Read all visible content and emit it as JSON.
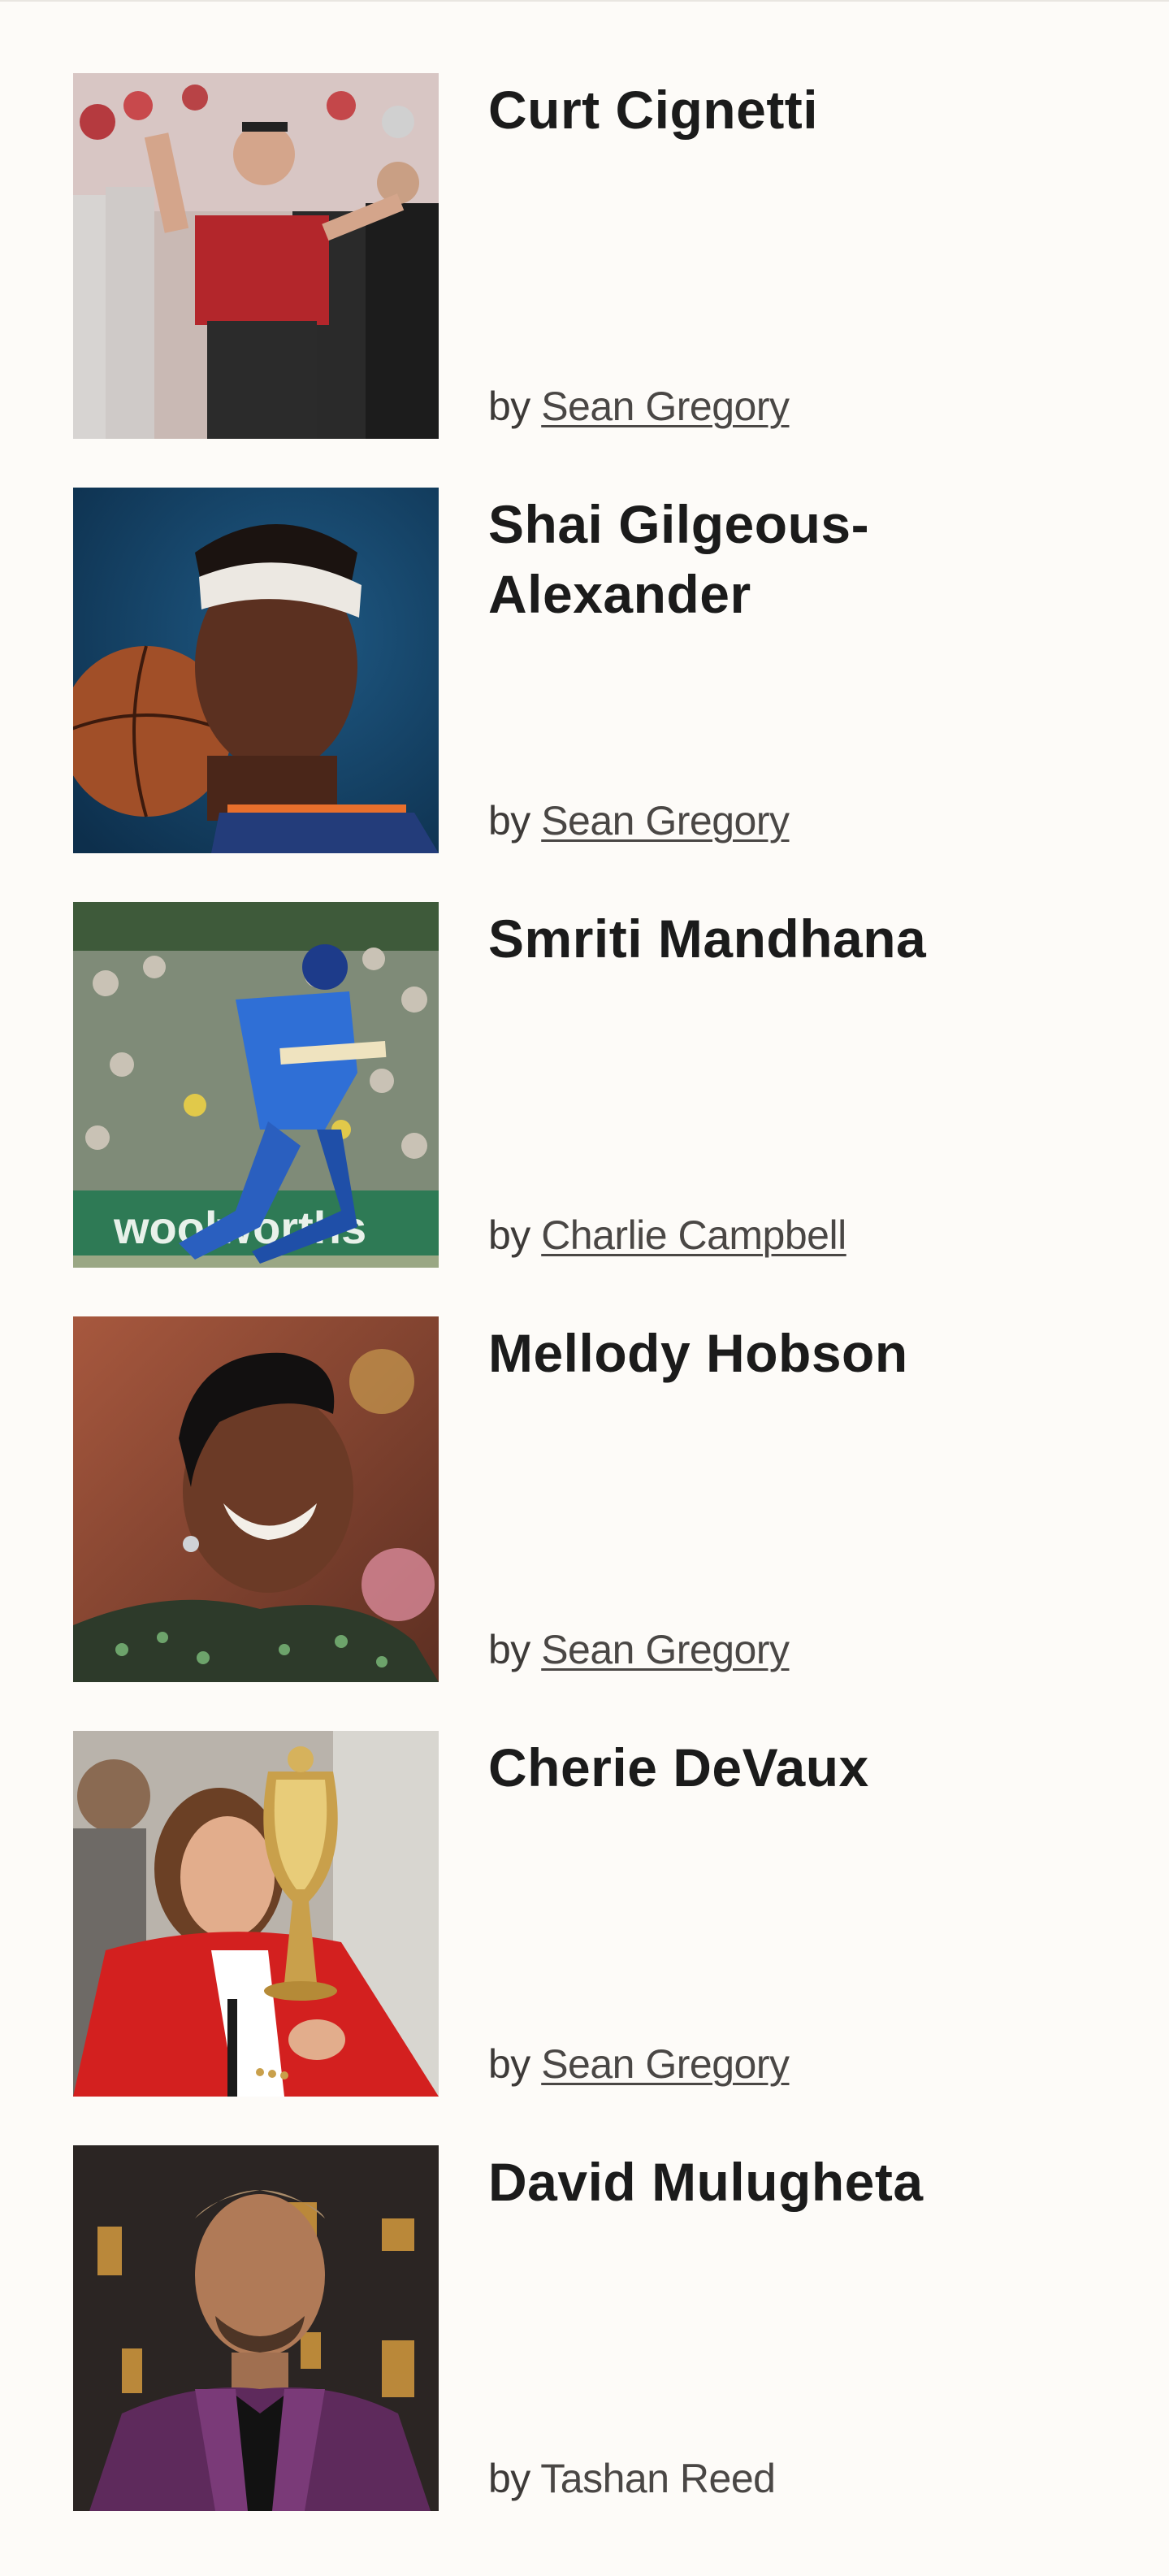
{
  "colors": {
    "background": "#fdfbf8",
    "title_text": "#1b1b1b",
    "byline_text": "#3d3a38"
  },
  "articles": [
    {
      "name": "Curt Cignetti",
      "by_prefix": "by",
      "author": "Sean Gregory",
      "author_linked": true,
      "image_icon": "photo-coach-sideline"
    },
    {
      "name": "Shai Gilgeous-Alexander",
      "by_prefix": "by",
      "author": "Sean Gregory",
      "author_linked": true,
      "image_icon": "photo-basketball-player"
    },
    {
      "name": "Smriti Mandhana",
      "by_prefix": "by",
      "author": "Charlie Campbell",
      "author_linked": true,
      "image_icon": "photo-cricket-batter"
    },
    {
      "name": "Mellody Hobson",
      "by_prefix": "by",
      "author": "Sean Gregory",
      "author_linked": true,
      "image_icon": "photo-smiling-woman"
    },
    {
      "name": "Cherie DeVaux",
      "by_prefix": "by",
      "author": "Sean Gregory",
      "author_linked": true,
      "image_icon": "photo-trophy-kiss"
    },
    {
      "name": "David Mulugheta",
      "by_prefix": "by",
      "author": "Tashan Reed",
      "author_linked": false,
      "image_icon": "photo-man-purple-suit"
    }
  ]
}
